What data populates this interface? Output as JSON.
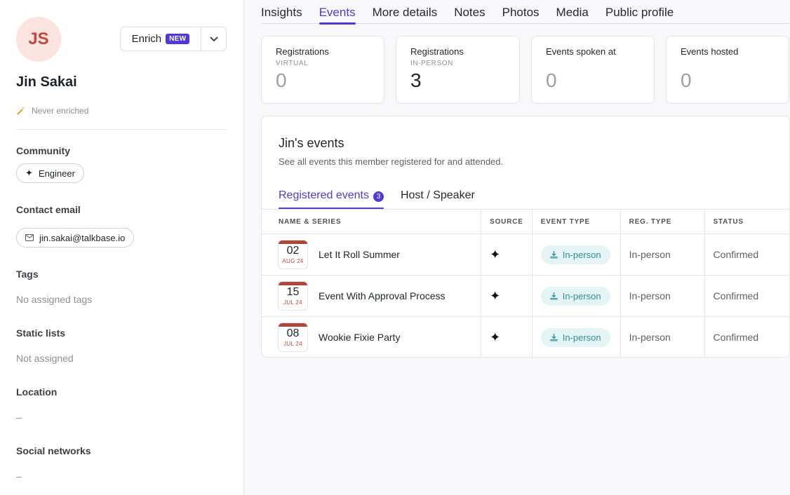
{
  "profile": {
    "initials": "JS",
    "name": "Jin Sakai",
    "enrich_label": "Enrich",
    "new_badge": "NEW",
    "enrich_status": "Never enriched"
  },
  "sections": {
    "community_label": "Community",
    "community_value": "Engineer",
    "contact_label": "Contact email",
    "contact_value": "jin.sakai@talkbase.io",
    "tags_label": "Tags",
    "tags_value": "No assigned tags",
    "static_label": "Static lists",
    "static_value": "Not assigned",
    "location_label": "Location",
    "location_value": "–",
    "social_label": "Social networks",
    "social_value": "–"
  },
  "tabs": [
    "Insights",
    "Events",
    "More details",
    "Notes",
    "Photos",
    "Media",
    "Public profile"
  ],
  "active_tab": "Events",
  "stats": [
    {
      "title": "Registrations",
      "sub": "VIRTUAL",
      "value": "0"
    },
    {
      "title": "Registrations",
      "sub": "IN-PERSON",
      "value": "3"
    },
    {
      "title": "Events spoken at",
      "sub": "",
      "value": "0"
    },
    {
      "title": "Events hosted",
      "sub": "",
      "value": "0"
    }
  ],
  "panel": {
    "title": "Jin's events",
    "description": "See all events this member registered for and attended.",
    "subtab_registered": "Registered events",
    "subtab_count": "3",
    "subtab_host": "Host / Speaker"
  },
  "table": {
    "headers": [
      "NAME & SERIES",
      "SOURCE",
      "EVENT TYPE",
      "REG. TYPE",
      "STATUS"
    ],
    "rows": [
      {
        "day": "02",
        "month": "AUG 24",
        "name": "Let It Roll Summer",
        "source": "✦",
        "event_type": "In-person",
        "reg_type": "In-person",
        "status": "Confirmed"
      },
      {
        "day": "15",
        "month": "JUL 24",
        "name": "Event With Approval Process",
        "source": "✦",
        "event_type": "In-person",
        "reg_type": "In-person",
        "status": "Confirmed"
      },
      {
        "day": "08",
        "month": "JUL 24",
        "name": "Wookie Fixie Party",
        "source": "✦",
        "event_type": "In-person",
        "reg_type": "In-person",
        "status": "Confirmed"
      }
    ]
  },
  "colors": {
    "accent": "#4f3ad6",
    "teal": "#2f8f96",
    "calendar": "#b0463b"
  }
}
